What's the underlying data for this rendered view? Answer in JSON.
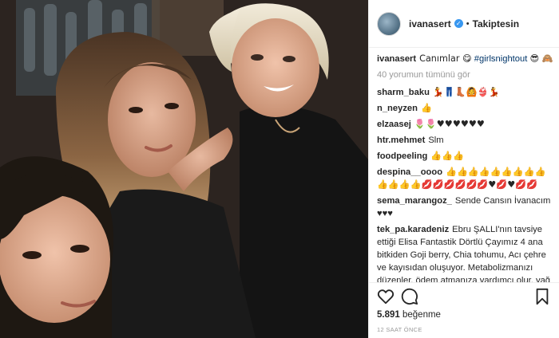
{
  "post": {
    "username": "ivanasert",
    "follow_status": "Takiptesin",
    "caption_user": "ivanasert",
    "caption_text": "Canımlar 😋",
    "caption_tag": "#girlsnightout",
    "caption_emoji": "😎 🙈",
    "load_more": "40 yorumun tümünü gör",
    "likes_count": "5.891",
    "likes_label": "beğenme",
    "timestamp": "12 SAAT ÖNCE"
  },
  "comments": [
    {
      "user": "sharm_baku",
      "text": "💃👖👢🙆👙💃"
    },
    {
      "user": "n_neyzen",
      "text": "👍"
    },
    {
      "user": "elzaasej",
      "text": "🌷🌷♥♥♥♥♥♥"
    },
    {
      "user": "htr.mehmet",
      "text": "Slm"
    },
    {
      "user": "foodpeeling",
      "text": "👍👍👍"
    },
    {
      "user": "despina__oooo",
      "text": "👍👍👍👍👍👍👍👍👍👍👍👍👍💋💋💋💋💋💋♥💋♥💋💋"
    },
    {
      "user": "sema_marangoz_",
      "text": "Sende Cansın İvanacım ♥♥♥"
    },
    {
      "user": "tek_pa.karadeniz",
      "text": "Ebru ŞALLI'nın tavsiye ettiği Elisa Fantastik Dörtlü Çayımız 4 ana bitkiden Goji berry, Chia tohumu, Acı çehre ve kayısıdan oluşuyor. Metabolizmanızı düzenler, ödem atmanıza yardımcı olur, yağ"
    }
  ],
  "colors": {
    "verified": "#3897f0",
    "text": "#262626",
    "muted": "#999999",
    "border": "#efefef"
  },
  "icons": [
    "heart-icon",
    "comment-icon",
    "bookmark-icon",
    "verified-badge-icon"
  ]
}
